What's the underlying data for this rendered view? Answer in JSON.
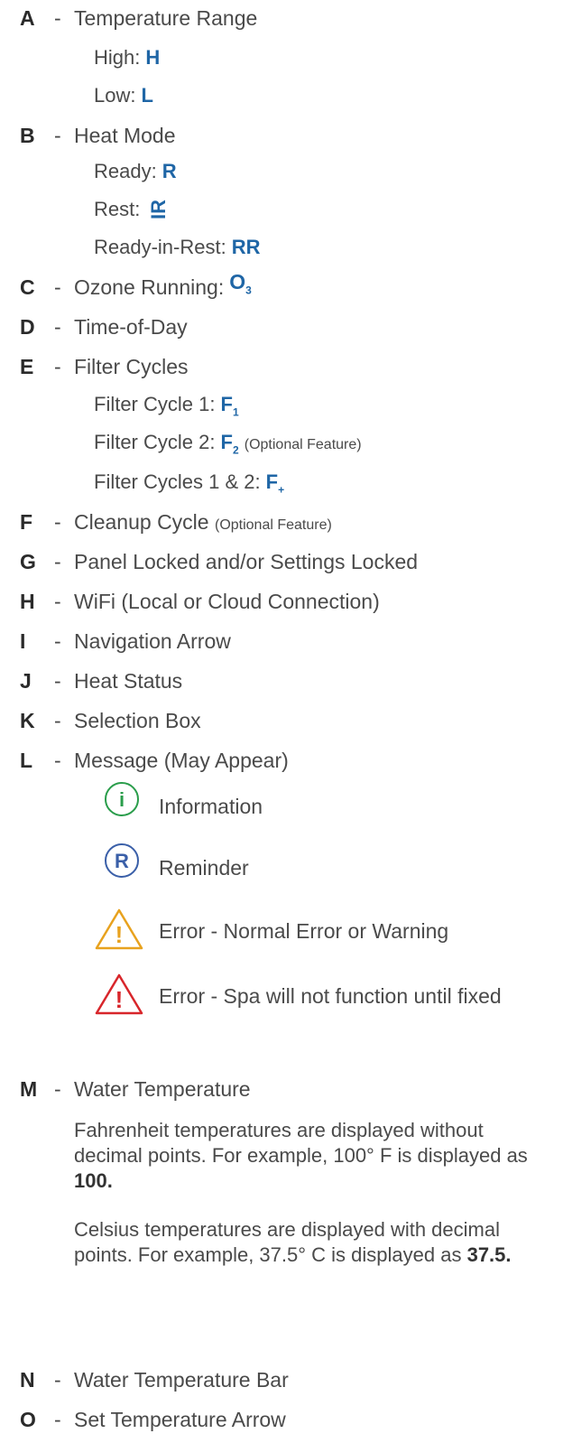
{
  "items": {
    "A": {
      "key": "A",
      "label": "Temperature Range"
    },
    "A_high": {
      "label": "High:",
      "sym": "H"
    },
    "A_low": {
      "label": "Low:",
      "sym": "L"
    },
    "B": {
      "key": "B",
      "label": "Heat Mode"
    },
    "B_ready": {
      "label": "Ready:",
      "sym": "R"
    },
    "B_rest": {
      "label": "Rest:",
      "sym": "IR"
    },
    "B_rir": {
      "label": "Ready-in-Rest:",
      "sym": "RR"
    },
    "C": {
      "key": "C",
      "label": "Ozone Running:",
      "sym": "O",
      "sub": "3"
    },
    "D": {
      "key": "D",
      "label": "Time-of-Day"
    },
    "E": {
      "key": "E",
      "label": "Filter Cycles"
    },
    "E_1": {
      "label": "Filter Cycle 1:",
      "sym": "F",
      "sub": "1"
    },
    "E_2": {
      "label": "Filter Cycle 2:",
      "sym": "F",
      "sub": "2",
      "note": "(Optional Feature)"
    },
    "E_12": {
      "label": "Filter Cycles 1 & 2:",
      "sym": "F",
      "sub": "+"
    },
    "F": {
      "key": "F",
      "label": "Cleanup Cycle",
      "note": "(Optional Feature)"
    },
    "G": {
      "key": "G",
      "label": "Panel Locked and/or Settings Locked"
    },
    "H": {
      "key": "H",
      "label": "WiFi (Local or Cloud Connection)"
    },
    "I": {
      "key": "I",
      "label": "Navigation Arrow"
    },
    "J": {
      "key": "J",
      "label": "Heat Status"
    },
    "K": {
      "key": "K",
      "label": "Selection Box"
    },
    "L": {
      "key": "L",
      "label": "Message  (May Appear)"
    },
    "M": {
      "key": "M",
      "label": "Water Temperature"
    },
    "N": {
      "key": "N",
      "label": "Water Temperature Bar"
    },
    "O": {
      "key": "O",
      "label": "Set Temperature Arrow"
    }
  },
  "messages": [
    {
      "icon": "information-icon",
      "glyph": "i",
      "label": "Information",
      "color": "#2a9d4b"
    },
    {
      "icon": "reminder-icon",
      "glyph": "R",
      "label": "Reminder",
      "color": "#3a5fa8"
    },
    {
      "icon": "warning-icon",
      "glyph": "!",
      "label": "Error - Normal Error or Warning",
      "color": "#e8a21e"
    },
    {
      "icon": "error-icon",
      "glyph": "!",
      "label": "Error - Spa will not function until fixed",
      "color": "#d8262b"
    }
  ],
  "notes": {
    "fahrenheit": {
      "text": "Fahrenheit temperatures are displayed without decimal points. For example, 100° F is displayed as ",
      "value": "100."
    },
    "celsius": {
      "text": "Celsius temperatures are displayed with decimal points. For example, 37.5° C is displayed as ",
      "value": "37.5."
    }
  },
  "colors": {
    "accent": "#1f66a6",
    "text": "#4a4a4a"
  }
}
